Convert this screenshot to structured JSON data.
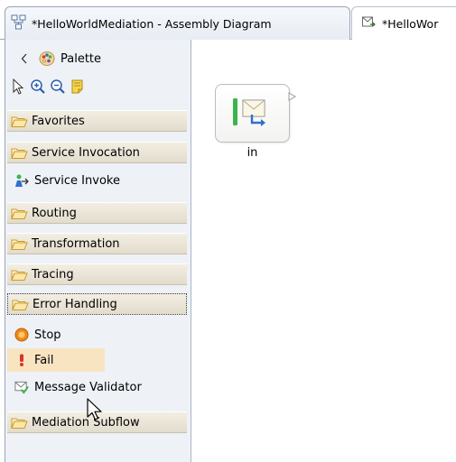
{
  "tabs": [
    {
      "label": "*HelloWorldMediation - Assembly Diagram",
      "active": true,
      "icon": "assembly-diagram-icon"
    },
    {
      "label": "*HelloWor",
      "active": false,
      "icon": "mediation-flow-icon"
    }
  ],
  "palette": {
    "title": "Palette",
    "collapse_icon": "chevron-left-icon",
    "tools": [
      {
        "name": "select-tool-icon"
      },
      {
        "name": "zoom-in-icon"
      },
      {
        "name": "zoom-out-icon"
      },
      {
        "name": "note-icon"
      }
    ],
    "drawers": {
      "favorites": "Favorites",
      "service_invocation": "Service Invocation",
      "routing": "Routing",
      "transformation": "Transformation",
      "tracing": "Tracing",
      "error_handling": "Error Handling",
      "mediation_subflow": "Mediation Subflow"
    },
    "entries": {
      "service_invoke": "Service Invoke",
      "stop": "Stop",
      "fail": "Fail",
      "message_validator": "Message Validator"
    }
  },
  "canvas": {
    "node": {
      "label": "in",
      "icon": "input-node-icon"
    }
  },
  "colors": {
    "drawer_bg": "#e9e3d6",
    "hover_bg": "#f9e4c2",
    "palette_bg": "#eef1f6",
    "accent_green": "#3bb54a",
    "stop_orange": "#f08a14"
  }
}
